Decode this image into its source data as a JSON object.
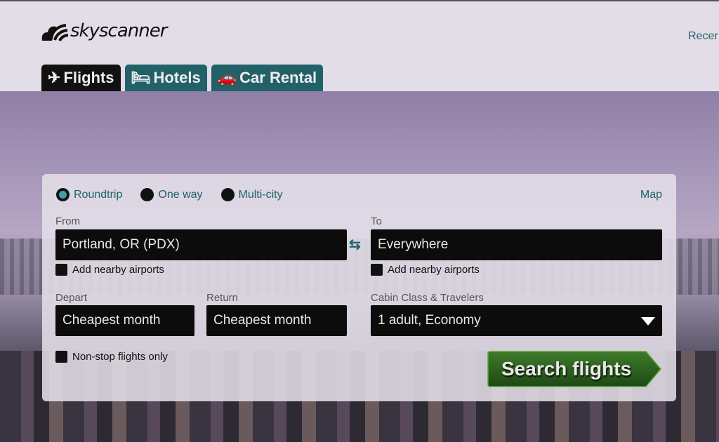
{
  "header": {
    "logo_text": "skyscanner",
    "recent_link": "Recer"
  },
  "tabs": [
    {
      "label": "Flights",
      "icon": "plane-icon",
      "active": true
    },
    {
      "label": "Hotels",
      "icon": "bed-icon"
    },
    {
      "label": "Car Rental",
      "icon": "car-icon"
    }
  ],
  "trip_types": [
    {
      "label": "Roundtrip",
      "selected": true
    },
    {
      "label": "One way"
    },
    {
      "label": "Multi-city"
    }
  ],
  "map_link": "Map",
  "from": {
    "label": "From",
    "value": "Portland, OR (PDX)",
    "nearby": "Add nearby airports"
  },
  "to": {
    "label": "To",
    "value": "Everywhere",
    "nearby": "Add nearby airports"
  },
  "depart": {
    "label": "Depart",
    "value": "Cheapest month"
  },
  "return": {
    "label": "Return",
    "value": "Cheapest month"
  },
  "cabin": {
    "label": "Cabin Class & Travelers",
    "value": "1 adult, Economy"
  },
  "nonstop": "Non-stop flights only",
  "search_button": "Search flights",
  "colors": {
    "accent": "#226167",
    "search_button": "#2d5e1f"
  }
}
